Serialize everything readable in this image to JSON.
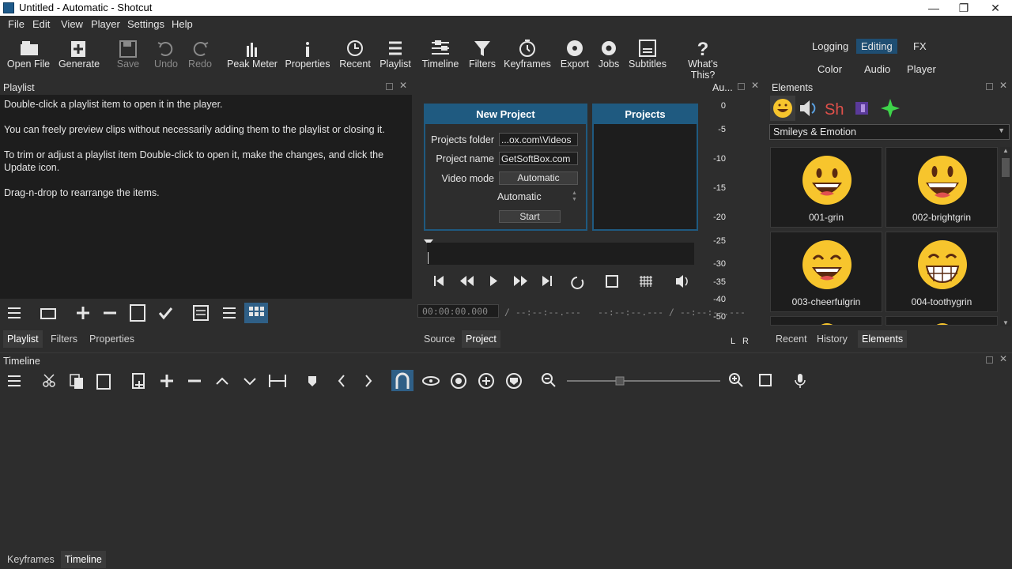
{
  "window": {
    "title": "Untitled - Automatic - Shotcut",
    "minimize": "—",
    "maximize": "❐",
    "close": "✕"
  },
  "menu": {
    "file": "File",
    "edit": "Edit",
    "view": "View",
    "player": "Player",
    "settings": "Settings",
    "help": "Help"
  },
  "toolbar": {
    "open_file": "Open File",
    "generate": "Generate",
    "save": "Save",
    "undo": "Undo",
    "redo": "Redo",
    "peak_meter": "Peak Meter",
    "properties": "Properties",
    "recent": "Recent",
    "playlist": "Playlist",
    "timeline": "Timeline",
    "filters": "Filters",
    "keyframes": "Keyframes",
    "export": "Export",
    "jobs": "Jobs",
    "subtitles": "Subtitles",
    "whats_this": "What's This?"
  },
  "layouts": {
    "logging": "Logging",
    "editing": "Editing",
    "fx": "FX",
    "color": "Color",
    "audio": "Audio",
    "player": "Player"
  },
  "playlist": {
    "title": "Playlist",
    "lines": [
      "Double-click a playlist item to open it in the player.",
      "You can freely preview clips without necessarily adding them to the playlist or closing it.",
      "To trim or adjust a playlist item Double-click to open it, make the changes, and click the Update icon.",
      "Drag-n-drop to rearrange the items."
    ],
    "tabs": [
      "Playlist",
      "Filters",
      "Properties"
    ]
  },
  "new_project": {
    "title": "New Project",
    "folder_label": "Projects folder",
    "folder_value": "...ox.com\\Videos",
    "name_label": "Project name",
    "name_value": "GetSoftBox.com",
    "mode_label": "Video mode",
    "mode_value": "Automatic",
    "sub_mode": "Automatic",
    "start": "Start"
  },
  "projects": {
    "title": "Projects"
  },
  "player": {
    "timecode": "00:00:00.000",
    "duration": "/ --:--:--.---",
    "in_out": "--:--:--.--- / --:--:--.---",
    "tabs": [
      "Source",
      "Project"
    ]
  },
  "audio": {
    "title": "Au...",
    "scale": [
      "0",
      "-5",
      "-10",
      "-15",
      "-20",
      "-25",
      "-30",
      "-35",
      "-40",
      "-50"
    ],
    "left": "L",
    "right": "R"
  },
  "elements": {
    "title": "Elements",
    "category": "Smileys & Emotion",
    "items": [
      "001-grin",
      "002-brightgrin",
      "003-cheerfulgrin",
      "004-toothygrin"
    ],
    "tabs": [
      "Recent",
      "History",
      "Elements"
    ]
  },
  "timeline": {
    "title": "Timeline",
    "bottom_tabs": [
      "Keyframes",
      "Timeline"
    ]
  },
  "colors": {
    "accent": "#1f5a80",
    "bg": "#2d2d2d",
    "panel": "#1d1d1d"
  }
}
